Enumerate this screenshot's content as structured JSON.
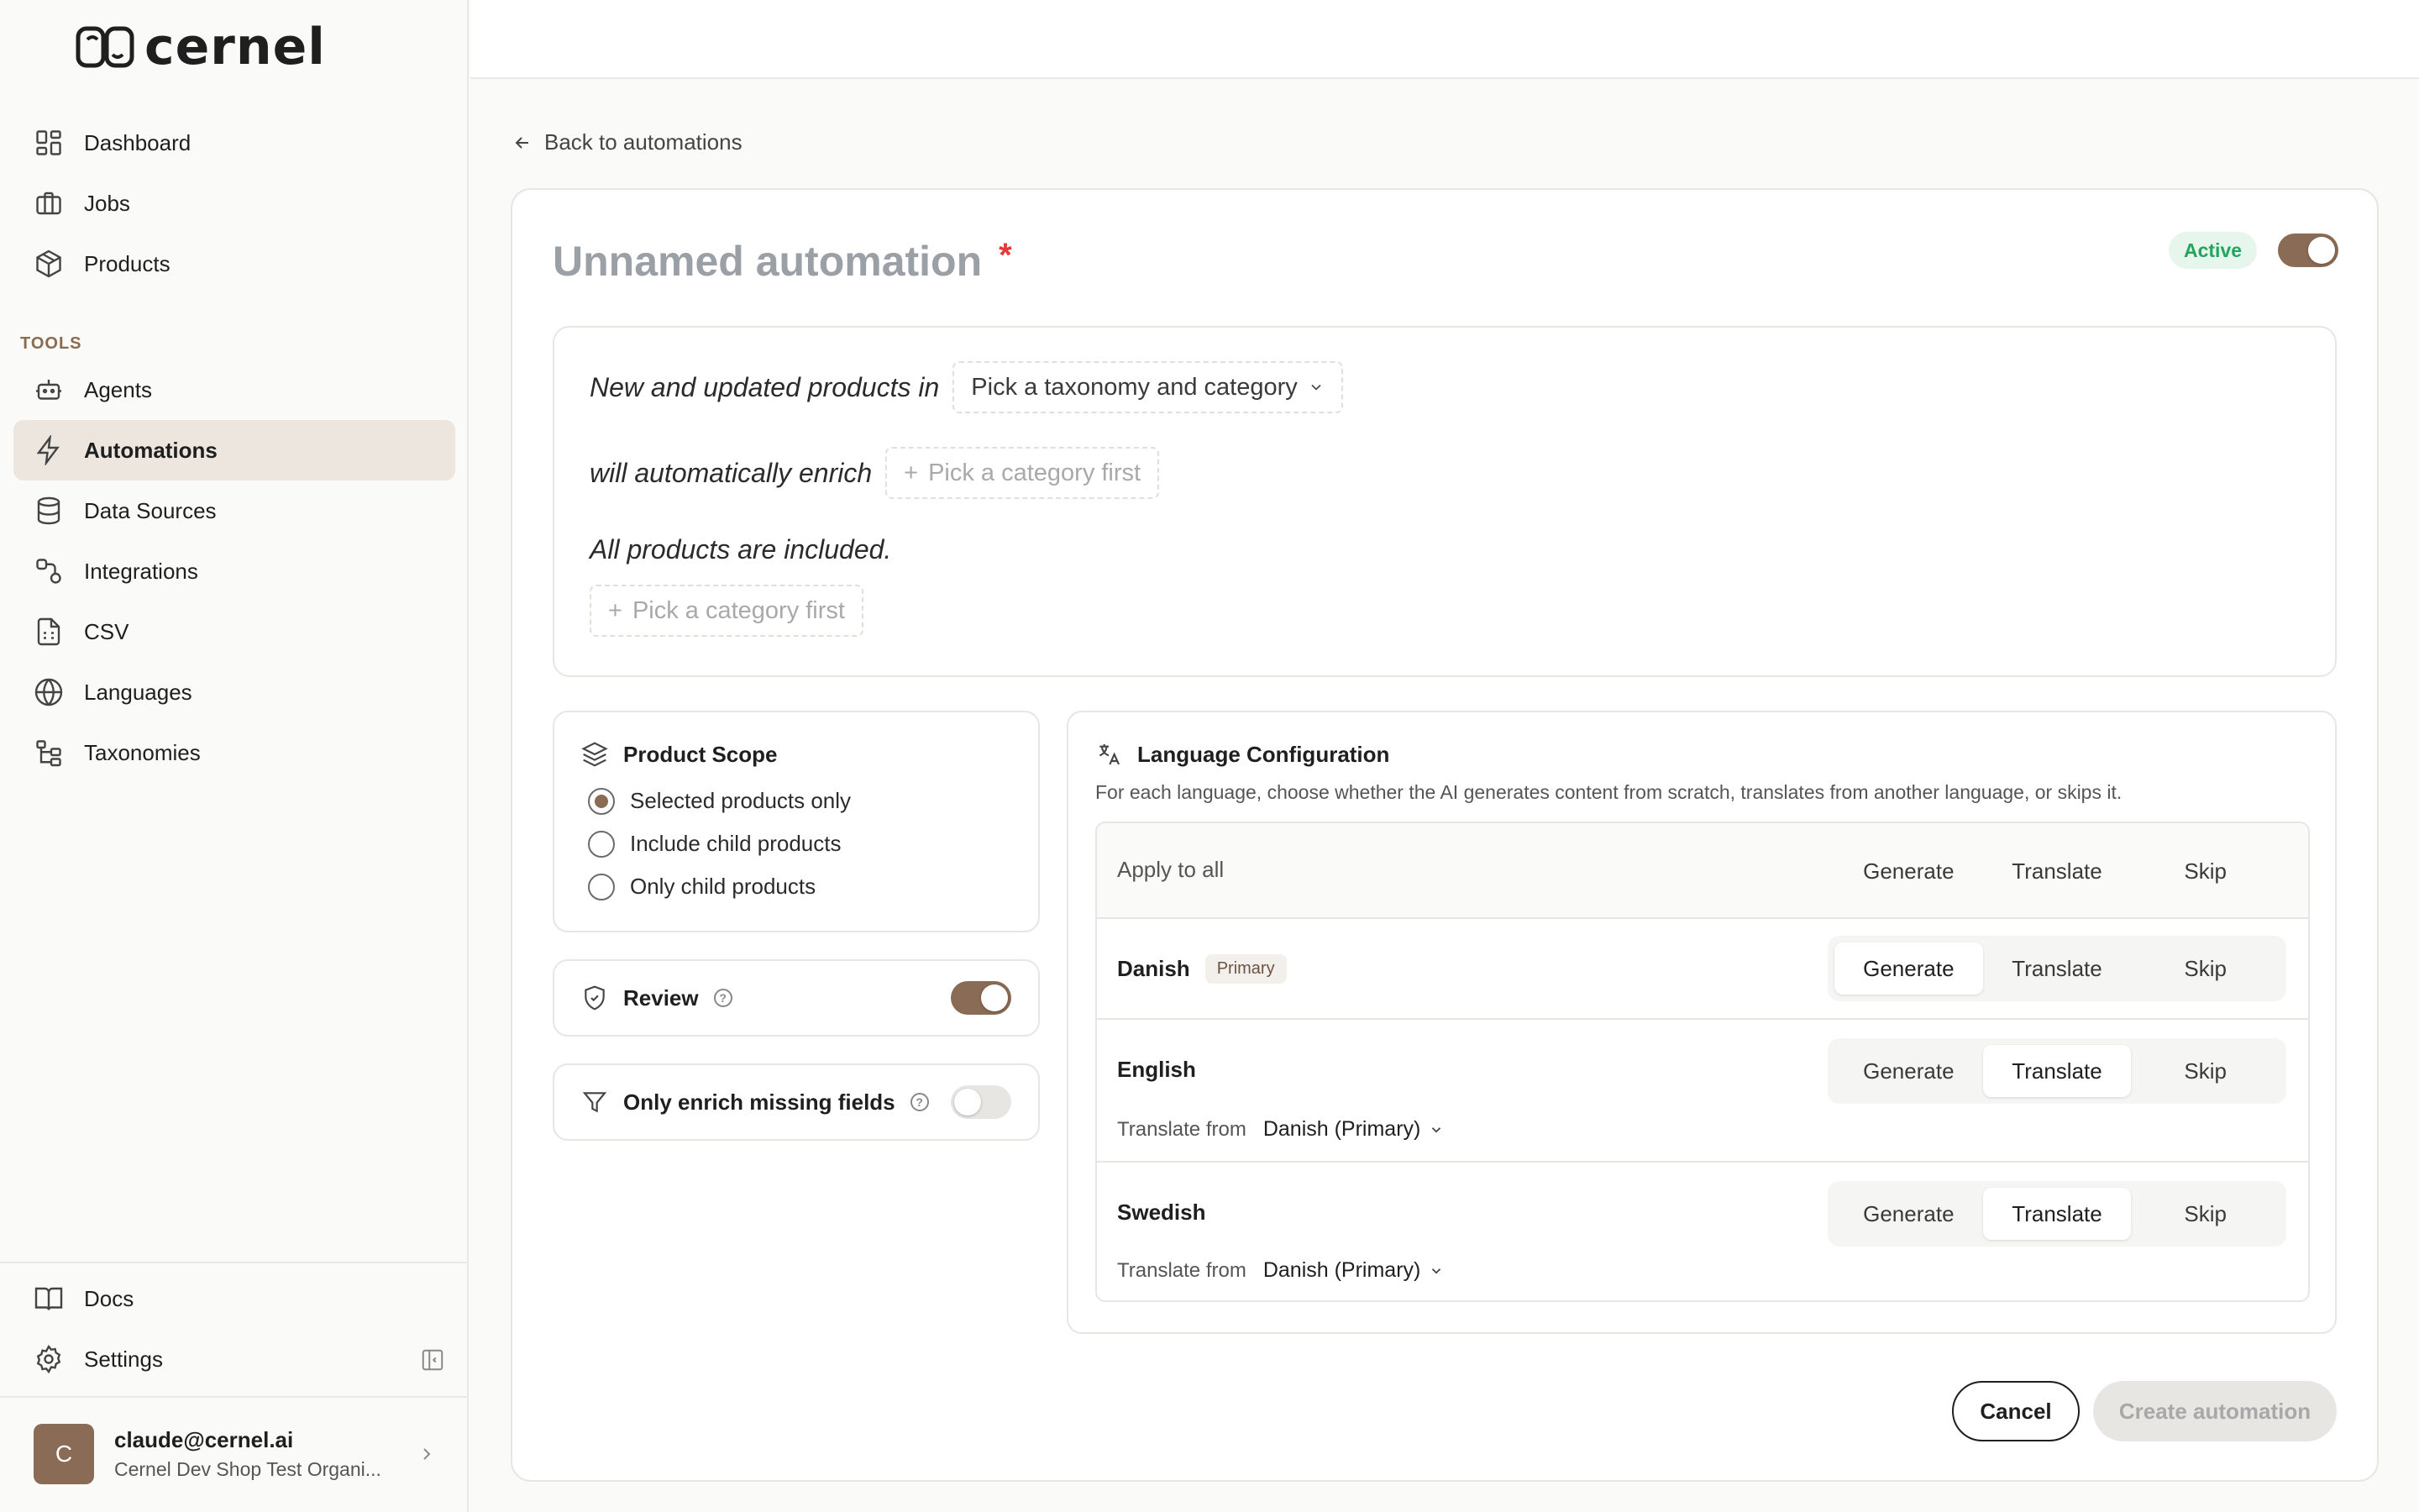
{
  "app": {
    "logo_text": "cernel"
  },
  "sidebar": {
    "nav_items": [
      {
        "label": "Dashboard",
        "icon": "dashboard-icon"
      },
      {
        "label": "Jobs",
        "icon": "briefcase-icon"
      },
      {
        "label": "Products",
        "icon": "box-icon"
      }
    ],
    "tools_label": "TOOLS",
    "tool_items": [
      {
        "label": "Agents",
        "icon": "robot-icon"
      },
      {
        "label": "Automations",
        "icon": "lightning-icon",
        "active": true
      },
      {
        "label": "Data Sources",
        "icon": "database-icon"
      },
      {
        "label": "Integrations",
        "icon": "integrations-icon"
      },
      {
        "label": "CSV",
        "icon": "csv-file-icon"
      },
      {
        "label": "Languages",
        "icon": "globe-icon"
      },
      {
        "label": "Taxonomies",
        "icon": "tree-icon"
      }
    ],
    "bottom_items": [
      {
        "label": "Docs",
        "icon": "book-icon"
      },
      {
        "label": "Settings",
        "icon": "gear-icon"
      }
    ],
    "user": {
      "avatar_initial": "C",
      "email": "claude@cernel.ai",
      "org": "Cernel Dev Shop Test Organi..."
    }
  },
  "main": {
    "back_label": "Back to automations",
    "title": "Unnamed automation",
    "required_mark": "*",
    "status_badge": "Active",
    "status_on": true,
    "sentence": {
      "line1_text": "New and updated products in",
      "line1_pick": "Pick a taxonomy and category",
      "line2_text": "will automatically enrich",
      "line2_pick": "Pick a category first",
      "line3_text": "All products are included.",
      "line3_pick": "Pick a category first"
    },
    "product_scope": {
      "title": "Product Scope",
      "options": [
        "Selected products only",
        "Include child products",
        "Only child products"
      ],
      "selected_index": 0
    },
    "review": {
      "label": "Review",
      "on": true
    },
    "missing_fields": {
      "label": "Only enrich missing fields",
      "on": false
    },
    "language_config": {
      "title": "Language Configuration",
      "description": "For each language, choose whether the AI generates content from scratch, translates from another language, or skips it.",
      "apply_all_label": "Apply to all",
      "options": [
        "Generate",
        "Translate",
        "Skip"
      ],
      "rows": [
        {
          "name": "Danish",
          "badge": "Primary",
          "selected": "Generate"
        },
        {
          "name": "English",
          "selected": "Translate",
          "translate_from_label": "Translate from",
          "translate_from_value": "Danish (Primary)"
        },
        {
          "name": "Swedish",
          "selected": "Translate",
          "translate_from_label": "Translate from",
          "translate_from_value": "Danish (Primary)"
        }
      ]
    },
    "cancel_label": "Cancel",
    "create_label": "Create automation"
  },
  "colors": {
    "accent": "#8a6b55",
    "active_nav_bg": "#ece6df",
    "active_badge_bg": "#e6f6ec",
    "active_badge_text": "#22a45d",
    "required": "#e53935"
  }
}
